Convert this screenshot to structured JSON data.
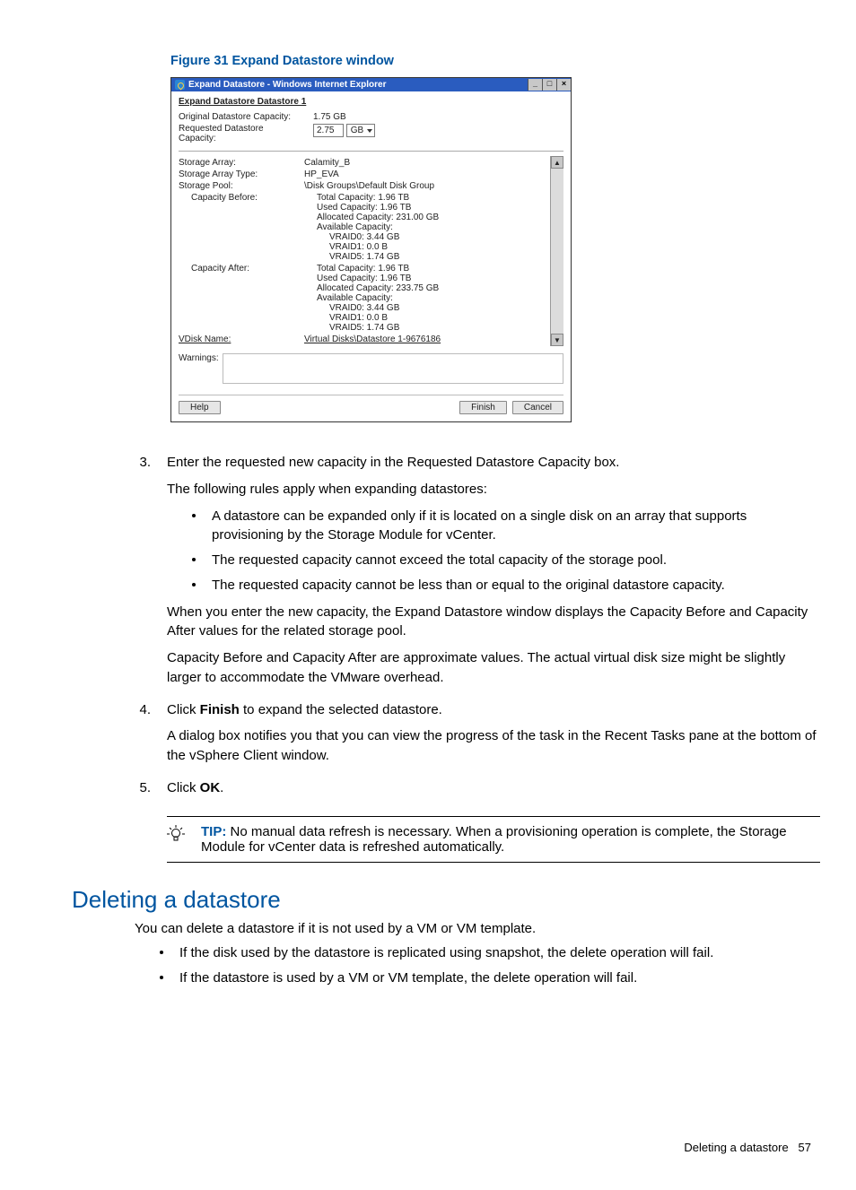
{
  "figure_caption": "Figure 31 Expand Datastore window",
  "window": {
    "title": "Expand Datastore - Windows Internet Explorer",
    "heading": "Expand Datastore Datastore 1",
    "original_capacity_label": "Original Datastore Capacity:",
    "original_capacity_value": "1.75 GB",
    "requested_capacity_label": "Requested Datastore Capacity:",
    "requested_value": "2.75",
    "requested_unit": "GB",
    "storage_array_label": "Storage Array:",
    "storage_array_value": "Calamity_B",
    "storage_array_type_label": "Storage Array Type:",
    "storage_array_type_value": "HP_EVA",
    "storage_pool_label": "Storage Pool:",
    "storage_pool_value": "\\Disk Groups\\Default Disk Group",
    "capacity_before_label": "Capacity Before:",
    "before": {
      "total": "Total Capacity: 1.96 TB",
      "used": "Used Capacity: 1.96 TB",
      "allocated": "Allocated Capacity: 231.00 GB",
      "available": "Available Capacity:",
      "vraid0": "VRAID0: 3.44 GB",
      "vraid1": "VRAID1: 0.0 B",
      "vraid5": "VRAID5: 1.74 GB"
    },
    "capacity_after_label": "Capacity After:",
    "after": {
      "total": "Total Capacity: 1.96 TB",
      "used": "Used Capacity: 1.96 TB",
      "allocated": "Allocated Capacity: 233.75 GB",
      "available": "Available Capacity:",
      "vraid0": "VRAID0: 3.44 GB",
      "vraid1": "VRAID1: 0.0 B",
      "vraid5": "VRAID5: 1.74 GB"
    },
    "vdisk_label": "VDisk Name:",
    "vdisk_value": "Virtual Disks\\Datastore 1-9676186",
    "warnings_label": "Warnings:",
    "help_btn": "Help",
    "finish_btn": "Finish",
    "cancel_btn": "Cancel"
  },
  "step3": {
    "num": "3.",
    "p1": "Enter the requested new capacity in the Requested Datastore Capacity box.",
    "p2": "The following rules apply when expanding datastores:",
    "b1": "A datastore can be expanded only if it is located on a single disk on an array that supports provisioning by the Storage Module for vCenter.",
    "b2": "The requested capacity cannot exceed the total capacity of the storage pool.",
    "b3": "The requested capacity cannot be less than or equal to the original datastore capacity.",
    "p3": "When you enter the new capacity, the Expand Datastore window displays the Capacity Before and Capacity After values for the related storage pool.",
    "p4": "Capacity Before and Capacity After are approximate values. The actual virtual disk size might be slightly larger to accommodate the VMware overhead."
  },
  "step4": {
    "num": "4.",
    "p1a": "Click ",
    "p1b": "Finish",
    "p1c": " to expand the selected datastore.",
    "p2": "A dialog box notifies you that you can view the progress of the task in the Recent Tasks pane at the bottom of the vSphere Client window."
  },
  "step5": {
    "num": "5.",
    "p1a": "Click ",
    "p1b": "OK",
    "p1c": "."
  },
  "tip": {
    "label": "TIP:",
    "text": " No manual data refresh is necessary. When a provisioning operation is complete, the Storage Module for vCenter data is refreshed automatically."
  },
  "section_heading": "Deleting a datastore",
  "delete_p": "You can delete a datastore if it is not used by a VM or VM template.",
  "delete_b1": "If the disk used by the datastore is replicated using snapshot, the delete operation will fail.",
  "delete_b2": "If the datastore is used by a VM or VM template, the delete operation will fail.",
  "footer_text": "Deleting a datastore",
  "footer_page": "57"
}
